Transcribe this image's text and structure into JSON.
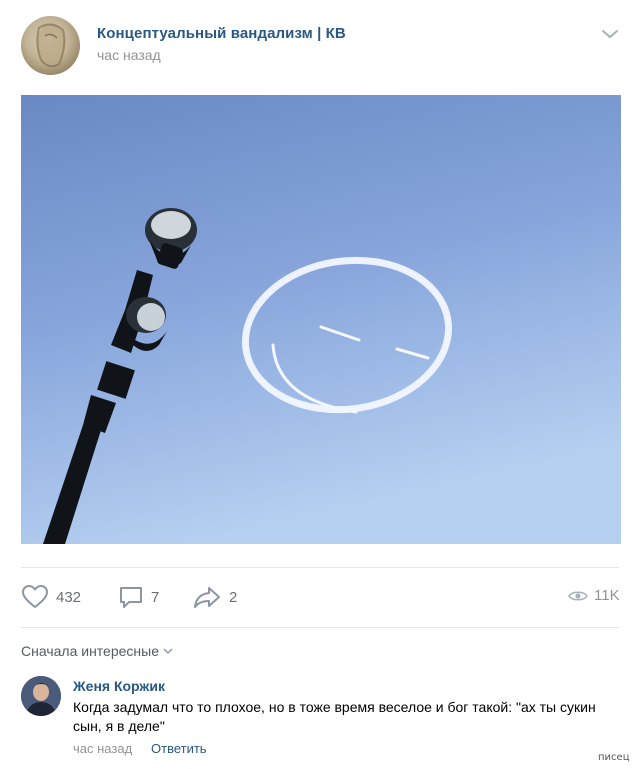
{
  "post": {
    "group_name": "Концептуальный вандализм | КВ",
    "time": "час назад"
  },
  "actions": {
    "likes": "432",
    "comments": "7",
    "shares": "2",
    "views": "11K"
  },
  "comments_sort": "Сначала интересные",
  "comment": {
    "author": "Женя Коржик",
    "text": "Когда задумал что то плохое, но в тоже время веселое и бог такой: \"ах ты сукин сын, я в деле\"",
    "time": "час назад",
    "reply_label": "Ответить"
  },
  "watermark": "писец",
  "colors": {
    "link": "#2a5885",
    "secondary": "#939393",
    "sky_top": "#6c8cc8",
    "sky_bottom": "#b0cbef"
  },
  "icons": {
    "menu": "chevron-down-icon",
    "like": "heart-icon",
    "comment": "comment-bubble-icon",
    "share": "share-arrow-icon",
    "views": "eye-icon",
    "sort": "chevron-down-small-icon"
  }
}
